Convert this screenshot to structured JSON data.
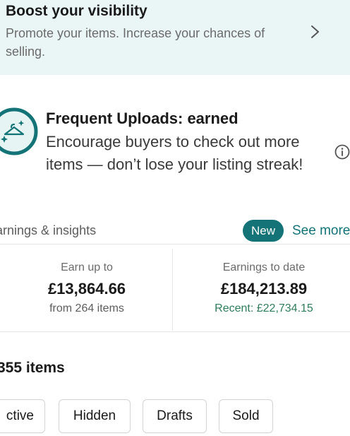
{
  "boost": {
    "title": "Boost your visibility",
    "subtitle": "Promote your items. Increase your chances of selling."
  },
  "badge": {
    "title": "Frequent Uploads: earned",
    "description": "Encourage buyers to check out more items — don’t lose your listing streak!"
  },
  "earnings": {
    "section_title": "arnings & insights",
    "new_label": "New",
    "see_more_label": "See more",
    "earn_up_to": {
      "label": "Earn up to",
      "value": "£13,864.66",
      "sub": "from 264 items"
    },
    "to_date": {
      "label": "Earnings to date",
      "value": "£184,213.89",
      "sub": "Recent: £22,734.15"
    }
  },
  "items": {
    "count_label": "355 items",
    "filters": [
      "ctive",
      "Hidden",
      "Drafts",
      "Sold"
    ]
  },
  "colors": {
    "accent": "#137377",
    "banner_bg": "#eaf6f6",
    "recent_green": "#2e7d5b"
  },
  "icons": {
    "boost": "chevron-right-icon",
    "badge": "hanger-sparkle-icon",
    "info": "info-icon"
  }
}
